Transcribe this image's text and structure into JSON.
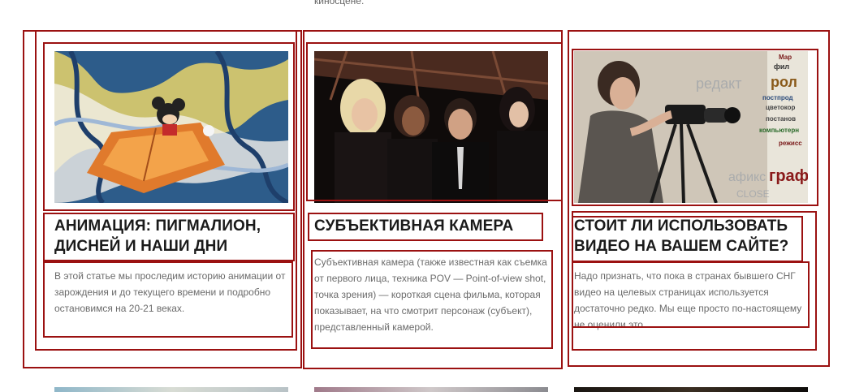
{
  "top_fragment": "киносцене.",
  "cards": [
    {
      "title": "Анимация: Пигмалион, Дисней и наши дни",
      "excerpt": "В этой статье мы проследим историю анимации от зарождения и до текущего времени и подробно остановимся на 20-21 веках.",
      "image": "animation-thumbnail"
    },
    {
      "title": "Субъективная камера",
      "excerpt": "Субъективная камера (также известная как съемка от первого лица, техника POV — Point-of-view shot, точка зрения) — короткая сцена фильма, которая показывает, на что смотрит персонаж (субъект), представленный камерой.",
      "image": "subjective-camera-thumbnail"
    },
    {
      "title": "Стоит ли использовать видео на вашем сайте?",
      "excerpt": "Надо признать, что пока в странах бывшего СНГ видео на целевых страницах используется достаточно редко. Мы еще просто по-настоящему не оценили это.",
      "image": "video-camera-thumbnail"
    }
  ],
  "colors": {
    "annotation_box": "#9b1111",
    "title": "#1a1a1a",
    "excerpt": "#6b6b6b"
  }
}
